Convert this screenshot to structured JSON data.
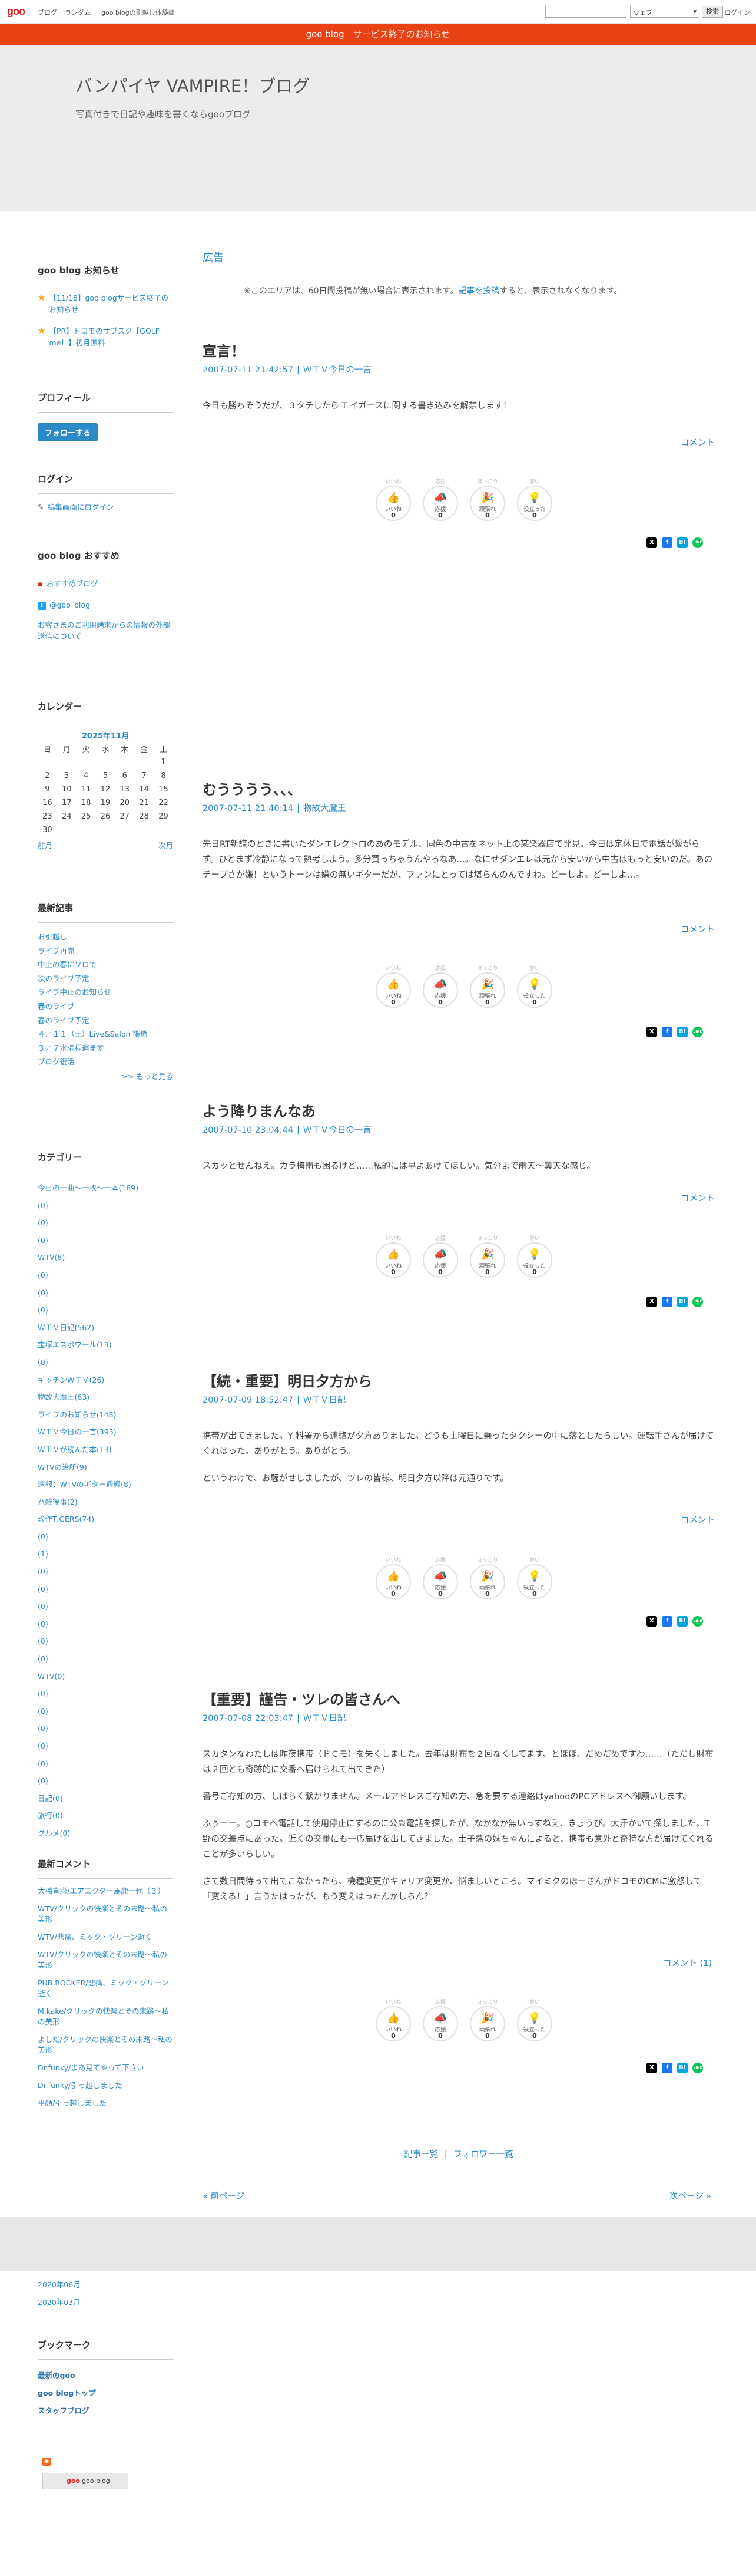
{
  "topbar": {
    "logo": "goo",
    "nav": [
      "ブログ",
      "ランダム",
      "goo blogの引越し体験談"
    ],
    "search_placeholder": "",
    "search_scope": "ウェブ",
    "search_button": "検索",
    "login": "ログイン"
  },
  "notice": "goo blog　サービス終了のお知らせ",
  "blog": {
    "title": "バンパイヤ VAMPIRE！ブログ",
    "description": "写真付きで日記や趣味を書くならgooブログ"
  },
  "sidebar": {
    "news": {
      "heading": "goo blog お知らせ",
      "items": [
        "【11/18】goo blogサービス終了のお知らせ",
        "【PR】ドコモのサブスク【GOLF me！】初月無料"
      ]
    },
    "profile": {
      "heading": "プロフィール",
      "follow": "フォローする"
    },
    "login": {
      "heading": "ログイン",
      "edit": "編集画面にログイン"
    },
    "recommend": {
      "heading": "goo blog おすすめ",
      "items": [
        "おすすめブログ",
        "@goo_blog",
        "お客さまのご利用端末からの情報の外部送信について"
      ]
    },
    "calendar": {
      "heading": "カレンダー",
      "month": "2025年11月",
      "weekdays": [
        "日",
        "月",
        "火",
        "水",
        "木",
        "金",
        "土"
      ],
      "weeks": [
        [
          "",
          "",
          "",
          "",
          "",
          "",
          "1"
        ],
        [
          "2",
          "3",
          "4",
          "5",
          "6",
          "7",
          "8"
        ],
        [
          "9",
          "10",
          "11",
          "12",
          "13",
          "14",
          "15"
        ],
        [
          "16",
          "17",
          "18",
          "19",
          "20",
          "21",
          "22"
        ],
        [
          "23",
          "24",
          "25",
          "26",
          "27",
          "28",
          "29"
        ],
        [
          "30",
          "",
          "",
          "",
          "",
          "",
          ""
        ]
      ],
      "prev": "前月",
      "next": "次月"
    },
    "recent": {
      "heading": "最新記事",
      "items": [
        "お引越し",
        "ライブ再開",
        "中止の春にソロで",
        "次のライブ予定",
        "ライブ中止のお知らせ",
        "春のライブ",
        "春のライブ予定",
        "４／１１（土）Live&Salon 衝燃",
        "３／７水曜程遅ます",
        "ブログ復活"
      ],
      "more": ">> もっと見る"
    },
    "category": {
      "heading": "カテゴリー",
      "items": [
        "今日の一曲～一枚～一本(189)",
        "(0)",
        "(0)",
        "(0)",
        "WTV(8)",
        "(0)",
        "(0)",
        "(0)",
        "ＷＴＶ日記(562)",
        "宝塚エスポワール(19)",
        "(0)",
        "キッチンＷＴＶ(26)",
        "物故大魔王(63)",
        "ライブのお知らせ(148)",
        "ＷＴＶ今日の一言(393)",
        "ＷＴＶが読んだ本(13)",
        "WTVの治所(9)",
        "速報：WTVのギター週態(8)",
        "ハ雑後事(2)",
        "珍作TIGERS(74)",
        "(0)",
        "(1)",
        "(0)",
        "(0)",
        "(0)",
        "(0)",
        "(0)",
        "(0)",
        "WTV(0)",
        "(0)",
        "(0)",
        "(0)",
        "(0)",
        "(0)",
        "(0)",
        "日記(0)",
        "旅行(0)",
        "グルメ(0)"
      ]
    },
    "comments": {
      "heading": "最新コメント",
      "items": [
        "大橋直彩/エアエクター馬鹿一代（３）",
        "WTV/クリックの快楽とその末路～私の美形",
        "WTV/悲痛、ミック・グリーン逝く",
        "WTV/クリックの快楽とその末路～私の美形",
        "PUB ROCKER/悲痛、ミック・グリーン逝く",
        "M.kake/クリックの快楽とその末路～私の美形",
        "よしだ/クリックの快楽とその末路～私の美形",
        "Dr.funky/まあ見てやって下さい",
        "Dr.funky/引っ越しました",
        "平顔/引っ越しました"
      ]
    },
    "archives": [
      "2020年06月",
      "2020年03月"
    ],
    "bookmark": {
      "heading": "ブックマーク",
      "items": [
        "最新のgoo",
        "goo blogトップ",
        "スタッフブログ"
      ],
      "badge": "goo blog"
    }
  },
  "ads": {
    "heading": "広告",
    "note_prefix": "※このエリアは、60日間投稿が無い場合に表示されます。",
    "note_link": "記事を投稿",
    "note_suffix": "すると、表示されなくなります。"
  },
  "reaction_labels": {
    "top": [
      "いいね",
      "応援",
      "ほっこり",
      "尊い"
    ],
    "names": [
      "いいね",
      "応援",
      "頑張れ",
      "役立った"
    ],
    "icons": [
      "thumbs-up",
      "megaphone",
      "cheer",
      "lightbulb"
    ]
  },
  "posts": [
    {
      "title": "宣言！",
      "date": "2007-07-11 21:42:57",
      "category": "ＷＴＶ今日の一言",
      "body": [
        "今日も勝ちそうだが、３タテしたら T イガースに関する書き込みを解禁します！"
      ],
      "comments": "コメント",
      "counts": [
        "0",
        "0",
        "0",
        "0"
      ]
    },
    {
      "title": "むうううう、、、",
      "date": "2007-07-11 21:40:14",
      "category": "物故大魔王",
      "body": [
        "先日RT新譜のときに書いたダンエレクトロのあのモデル、同色の中古をネット上の某楽器店で発見。今日は定休日で電話が繋がらず。ひとまず冷静になって熟考しよう。多分買っちゃうんやろなあ…。なにせダンエレは元から安いから中古はもっと安いのだ。あのチープさが嫌！というトーンは嫌の無いギターだが、ファンにとっては堪らんのんですわ。どーしよ。どーしよ…。"
      ],
      "comments": "コメント",
      "counts": [
        "0",
        "0",
        "0",
        "0"
      ]
    },
    {
      "title": "よう降りまんなあ",
      "date": "2007-07-10 23:04:44",
      "category": "ＷＴＶ今日の一言",
      "body": [
        "スカッとせんねえ。カラ梅雨も困るけど……私的には早よあけてほしい。気分まで雨天～曇天な感じ。"
      ],
      "comments": "コメント",
      "counts": [
        "0",
        "0",
        "0",
        "0"
      ]
    },
    {
      "title": "【続・重要】明日夕方から",
      "date": "2007-07-09 18:52:47",
      "category": "ＷＴＶ日記",
      "body": [
        "携帯が出てきました。Y 料署から連絡が夕方ありました。どうも土曜日に乗ったタクシーの中に落としたらしい。運転手さんが届けてくれはった。ありがとう。ありがとう。",
        "というわけで、お騒がせしましたが、ツレの皆様、明日夕方以降は元通りです。"
      ],
      "comments": "コメント",
      "counts": [
        "0",
        "0",
        "0",
        "0"
      ]
    },
    {
      "title": "【重要】謹告・ツレの皆さんへ",
      "date": "2007-07-08 22:03:47",
      "category": "ＷＴＶ日記",
      "body": [
        "スカタンなわたしは昨夜携帯（ドＣモ）を失くしました。去年は財布を２回なくしてます、とほほ、だめだめですわ……（ただし財布は２回とも奇跡的に交番へ届けられて出てきた）",
        "番号ご存知の方、しばらく繋がりません。メールアドレスご存知の方、急を要する連絡はyahooのPCアドレスへ御願いします。",
        "ふぅーー。○コモへ電話して使用停止にするのに公衆電話を探したが、なかなか無いっすねえ、きょうび。大汗かいて探しました。T野の交差点にあった。近くの交番にも一応届けを出してきました。土子藩の妹ちゃんによると、携帯も意外と奇特な方が届けてくれることが多いらしい。",
        "さて数日間待って出てこなかったら、機種変更かキャリア変更か、悩ましいところ。マイミクのほーさんがドコモのCMに激怒して「変える！」言うたはったが、もう変えはったんかしらん？"
      ],
      "comments": "コメント (1)",
      "counts": [
        "0",
        "0",
        "0",
        "0"
      ]
    }
  ],
  "bottom_nav": {
    "list": "記事一覧",
    "sep": "|",
    "follow_list": "フォロワー一覧"
  },
  "pager": {
    "prev": "« 前ページ",
    "next": "次ページ »"
  },
  "share_icons": [
    "X",
    "f",
    "B!",
    "LINE"
  ]
}
